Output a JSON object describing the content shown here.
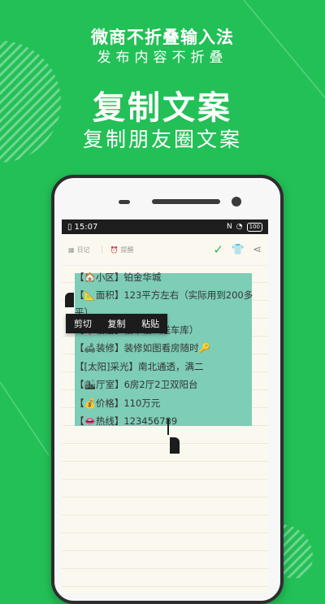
{
  "promo": {
    "title": "微商不折叠输入法",
    "subtitle": "发布内容不折叠",
    "headline": "复制文案",
    "tagline": "复制朋友圈文案"
  },
  "status_bar": {
    "time": "15:07",
    "battery": "100"
  },
  "toolbar": {
    "diary_label": "日记",
    "reminder_label": "提醒"
  },
  "note": {
    "rows": [
      {
        "icon": "🏠",
        "label": "小区",
        "value": "铂金华城"
      },
      {
        "icon": "📐",
        "label": "面积",
        "value": "123平方左右（实际用到200多平）"
      },
      {
        "icon": "🏢",
        "label": "楼层",
        "value": "楼中楼（送车库）"
      },
      {
        "icon": "🛋",
        "label": "装修",
        "value": "装修如图看房随时🔑"
      },
      {
        "icon": "",
        "label": "[太阳]采光",
        "value": "南北通透，满二"
      },
      {
        "icon": "🏙",
        "label": "厅室",
        "value": "6房2厅2卫双阳台"
      },
      {
        "icon": "💰",
        "label": "价格",
        "value": "110万元"
      },
      {
        "icon": "👄",
        "label": "热线",
        "value": "123456789"
      }
    ]
  },
  "context_menu": {
    "cut": "剪切",
    "copy": "复制",
    "paste": "粘贴"
  },
  "colors": {
    "background": "#23c057",
    "selection": "#7ecdb7",
    "accent": "#1fbf52"
  }
}
